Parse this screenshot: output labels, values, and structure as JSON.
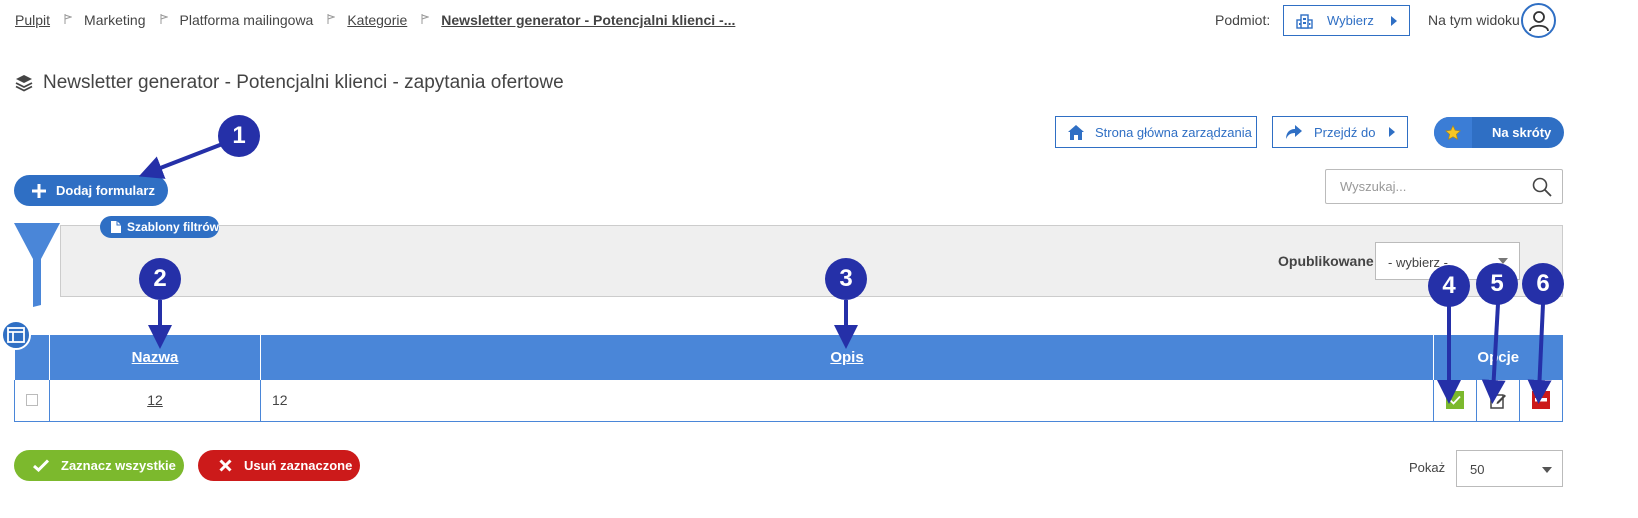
{
  "breadcrumb": {
    "items": [
      "Pulpit",
      "Marketing",
      "Platforma mailingowa",
      "Kategorie",
      "Newsletter generator - Potencjalni klienci -..."
    ]
  },
  "header": {
    "subject_label": "Podmiot:",
    "subject_button": "Wybierz",
    "view_label": "Na tym widoku"
  },
  "page": {
    "title": "Newsletter generator - Potencjalni klienci - zapytania ofertowe"
  },
  "actions": {
    "home": "Strona główna zarządzania",
    "goto": "Przejdź do",
    "shortcuts": "Na skróty",
    "add_form": "Dodaj formularz"
  },
  "search": {
    "placeholder": "Wyszukaj..."
  },
  "filters": {
    "templates": "Szablony filtrów",
    "published_label": "Opublikowane",
    "published_value": "- wybierz -"
  },
  "table": {
    "headers": {
      "name": "Nazwa",
      "description": "Opis",
      "options": "Opcje"
    },
    "rows": [
      {
        "name": "12",
        "description": "12"
      }
    ]
  },
  "footer": {
    "select_all": "Zaznacz wszystkie",
    "delete_selected": "Usuń zaznaczone",
    "show_label": "Pokaż",
    "page_size": "50"
  },
  "callouts": [
    "1",
    "2",
    "3",
    "4",
    "5",
    "6"
  ],
  "colors": {
    "primary": "#2f6fc4",
    "header_blue": "#4a86d8",
    "callout": "#2530a8",
    "success": "#7cb92d",
    "danger": "#cc1a1a"
  },
  "icons": {
    "crumb_separator": "flag-icon",
    "subject": "building-icon",
    "avatar": "user-icon",
    "title": "layers-icon",
    "home": "home-icon",
    "goto": "share-arrow-icon",
    "shortcuts": "star-icon",
    "add": "plus-icon",
    "search": "search-icon",
    "filter": "funnel-icon",
    "templates": "document-icon",
    "table_toggle": "table-layout-icon",
    "publish": "check-icon",
    "edit": "edit-icon",
    "delete": "minus-icon"
  }
}
